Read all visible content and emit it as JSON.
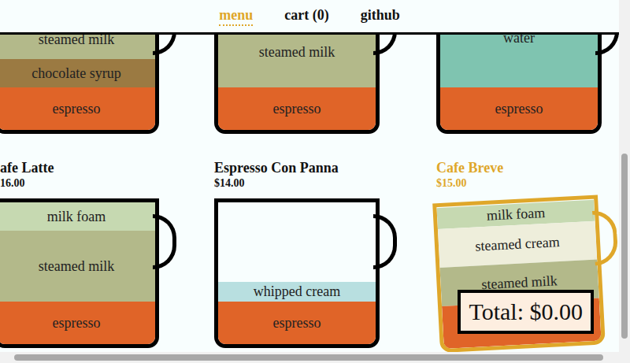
{
  "nav": [
    {
      "label": "menu",
      "selected": true
    },
    {
      "label": "cart (0)",
      "selected": false
    },
    {
      "label": "github",
      "selected": false
    }
  ],
  "items": [
    {
      "selected": false,
      "layers": [
        {
          "name": "steamed milk",
          "level": 0.27,
          "color": "#b3b98a"
        },
        {
          "name": "chocolate syrup",
          "level": 0.2,
          "color": "#9b7a42"
        },
        {
          "name": "espresso",
          "level": 0.3,
          "color": "#e06428"
        }
      ]
    },
    {
      "selected": false,
      "layers": [
        {
          "name": "steamed milk",
          "level": 0.5,
          "color": "#b3b98a"
        },
        {
          "name": "espresso",
          "level": 0.3,
          "color": "#e06428"
        }
      ]
    },
    {
      "selected": false,
      "layers": [
        {
          "name": "water",
          "level": 0.7,
          "color": "#7fc4b0"
        },
        {
          "name": "espresso",
          "level": 0.3,
          "color": "#e06428"
        }
      ]
    },
    {
      "name": "afe Latte",
      "price": "16.00",
      "selected": false,
      "layers": [
        {
          "name": "milk foam",
          "level": 0.2,
          "color": "#c6d9b1"
        },
        {
          "name": "steamed milk",
          "level": 0.5,
          "color": "#b3b98a"
        },
        {
          "name": "espresso",
          "level": 0.3,
          "color": "#e06428"
        }
      ]
    },
    {
      "name": "Espresso Con Panna",
      "price": "$14.00",
      "selected": false,
      "layers": [
        {
          "name": "whipped cream",
          "level": 0.14,
          "color": "#b8dfe0"
        },
        {
          "name": "espresso",
          "level": 0.3,
          "color": "#e06428"
        }
      ]
    },
    {
      "name": "Cafe Breve",
      "price": "$15.00",
      "selected": true,
      "layers": [
        {
          "name": "milk foam",
          "level": 0.15,
          "color": "#c6d9b1"
        },
        {
          "name": "steamed cream",
          "level": 0.27,
          "color": "#eeeedb"
        },
        {
          "name": "steamed milk",
          "level": 0.27,
          "color": "#b3b98a"
        },
        {
          "name": "espresso",
          "level": 0.3,
          "color": "#e06428"
        }
      ]
    }
  ],
  "total": "Total: $0.00"
}
